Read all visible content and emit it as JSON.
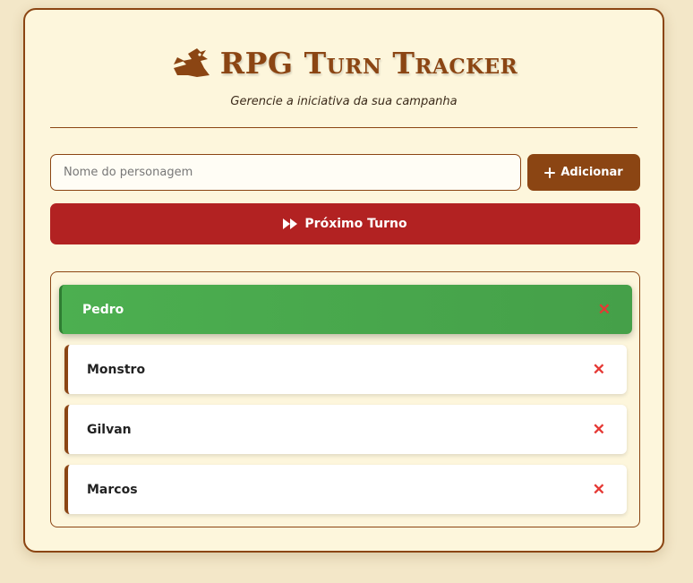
{
  "app": {
    "title": "RPG Turn Tracker",
    "subtitle": "Gerencie a iniciativa da sua campanha",
    "title_icon": "dragon-icon"
  },
  "controls": {
    "name_placeholder": "Nome do personagem",
    "name_value": "",
    "add_label": "Adicionar",
    "add_icon": "plus-icon",
    "next_label": "Próximo Turno",
    "next_icon": "fast-forward-icon"
  },
  "turn_order": [
    {
      "name": "Pedro",
      "active": true
    },
    {
      "name": "Monstro",
      "active": false
    },
    {
      "name": "Gilvan",
      "active": false
    },
    {
      "name": "Marcos",
      "active": false
    }
  ],
  "remove_glyph": "✕",
  "colors": {
    "background": "#f3e7c8",
    "card": "#fdf6dc",
    "brown_accent": "#8b4513",
    "next_button_red": "#b22222",
    "active_green": "#4caf50",
    "remove_red": "#e53935"
  }
}
